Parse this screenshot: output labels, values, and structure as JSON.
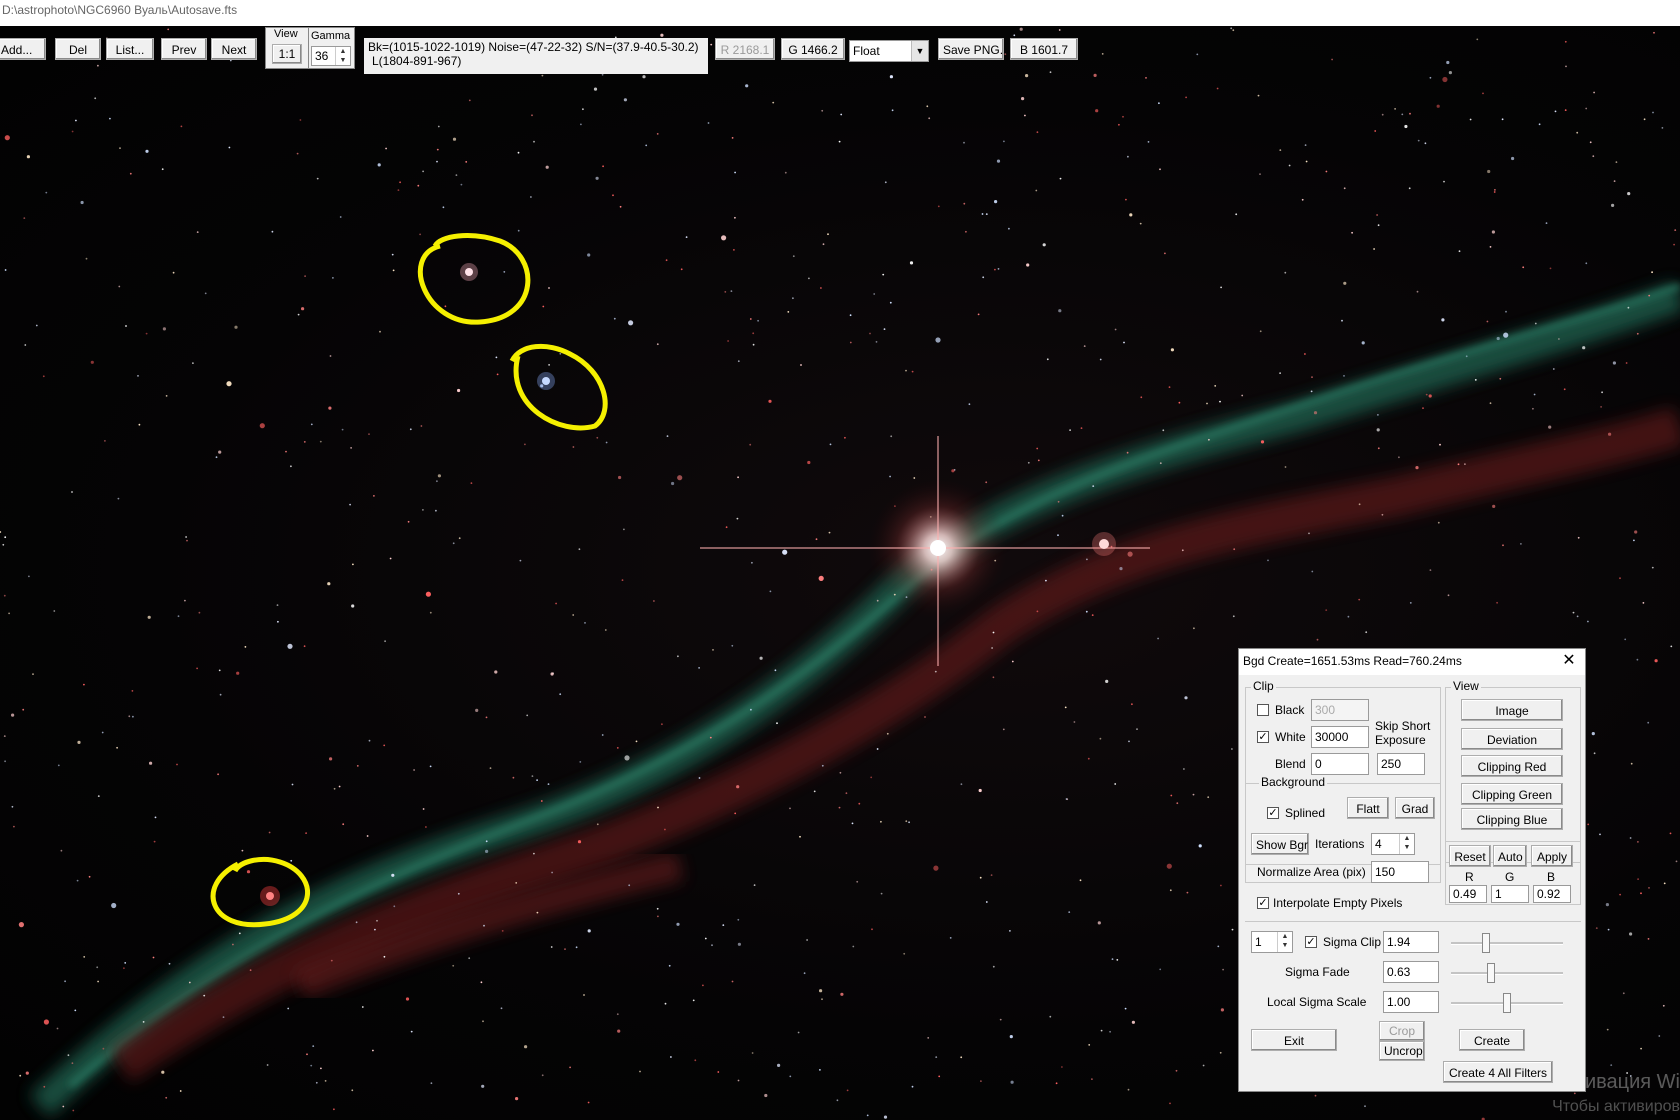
{
  "window": {
    "title": "D:\\astrophoto\\NGC6960 Вуаль\\Autosave.fts"
  },
  "toolbar": {
    "add": "Add...",
    "del": "Del",
    "list": "List...",
    "prev": "Prev",
    "next": "Next",
    "view_label": "View",
    "view_value": "1:1",
    "gamma_label": "Gamma",
    "gamma_value": "36",
    "stats_line1": "Bk=(1015-1022-1019) Noise=(47-22-32) S/N=(37.9-40.5-30.2)",
    "stats_line2": "L(1804-891-967)",
    "r_value": "R 2168.1",
    "g_value": "G 1466.2",
    "format_selected": "Float",
    "save_png": "Save PNG..",
    "b_value": "B 1601.7"
  },
  "dialog": {
    "title": "Bgd Create=1651.53ms Read=760.24ms",
    "clip": {
      "caption": "Clip",
      "black_label": "Black",
      "black_value": "300",
      "black_checked": false,
      "white_label": "White",
      "white_value": "30000",
      "white_checked": true,
      "blend_label": "Blend",
      "blend_value": "0",
      "skip_label_1": "Skip Short",
      "skip_label_2": "Exposure",
      "skip_value": "250"
    },
    "background": {
      "caption": "Background",
      "splined_label": "Splined",
      "splined_checked": true,
      "flatt": "Flatt",
      "grad": "Grad",
      "show_bgr": "Show Bgr",
      "iterations_label": "Iterations",
      "iterations_value": "4",
      "normalize_label": "Normalize Area (pix)",
      "normalize_value": "150"
    },
    "interpolate_label": "Interpolate Empty Pixels",
    "interpolate_checked": true,
    "view": {
      "caption": "View",
      "image": "Image",
      "deviation": "Deviation",
      "clip_red": "Clipping Red",
      "clip_green": "Clipping Green",
      "clip_blue": "Clipping Blue",
      "reset": "Reset",
      "auto": "Auto",
      "apply": "Apply",
      "r_label": "R",
      "g_label": "G",
      "b_label": "B",
      "r_value": "0.49",
      "g_value": "1",
      "b_value": "0.92"
    },
    "sigma": {
      "index_value": "1",
      "sigma_clip_label": "Sigma Clip",
      "sigma_clip_checked": true,
      "sigma_clip_value": "1.94",
      "sigma_fade_label": "Sigma Fade",
      "sigma_fade_value": "0.63",
      "local_scale_label": "Local Sigma Scale",
      "local_scale_value": "1.00"
    },
    "exit": "Exit",
    "crop": "Crop",
    "uncrop": "Uncrop",
    "create": "Create",
    "create_all": "Create 4 All Filters"
  },
  "watermark": {
    "line1": "Активация Wi",
    "line2": "Чтобы активиров"
  },
  "colors": {
    "annotation": "#f5f000",
    "panel": "#f0f0f0"
  }
}
